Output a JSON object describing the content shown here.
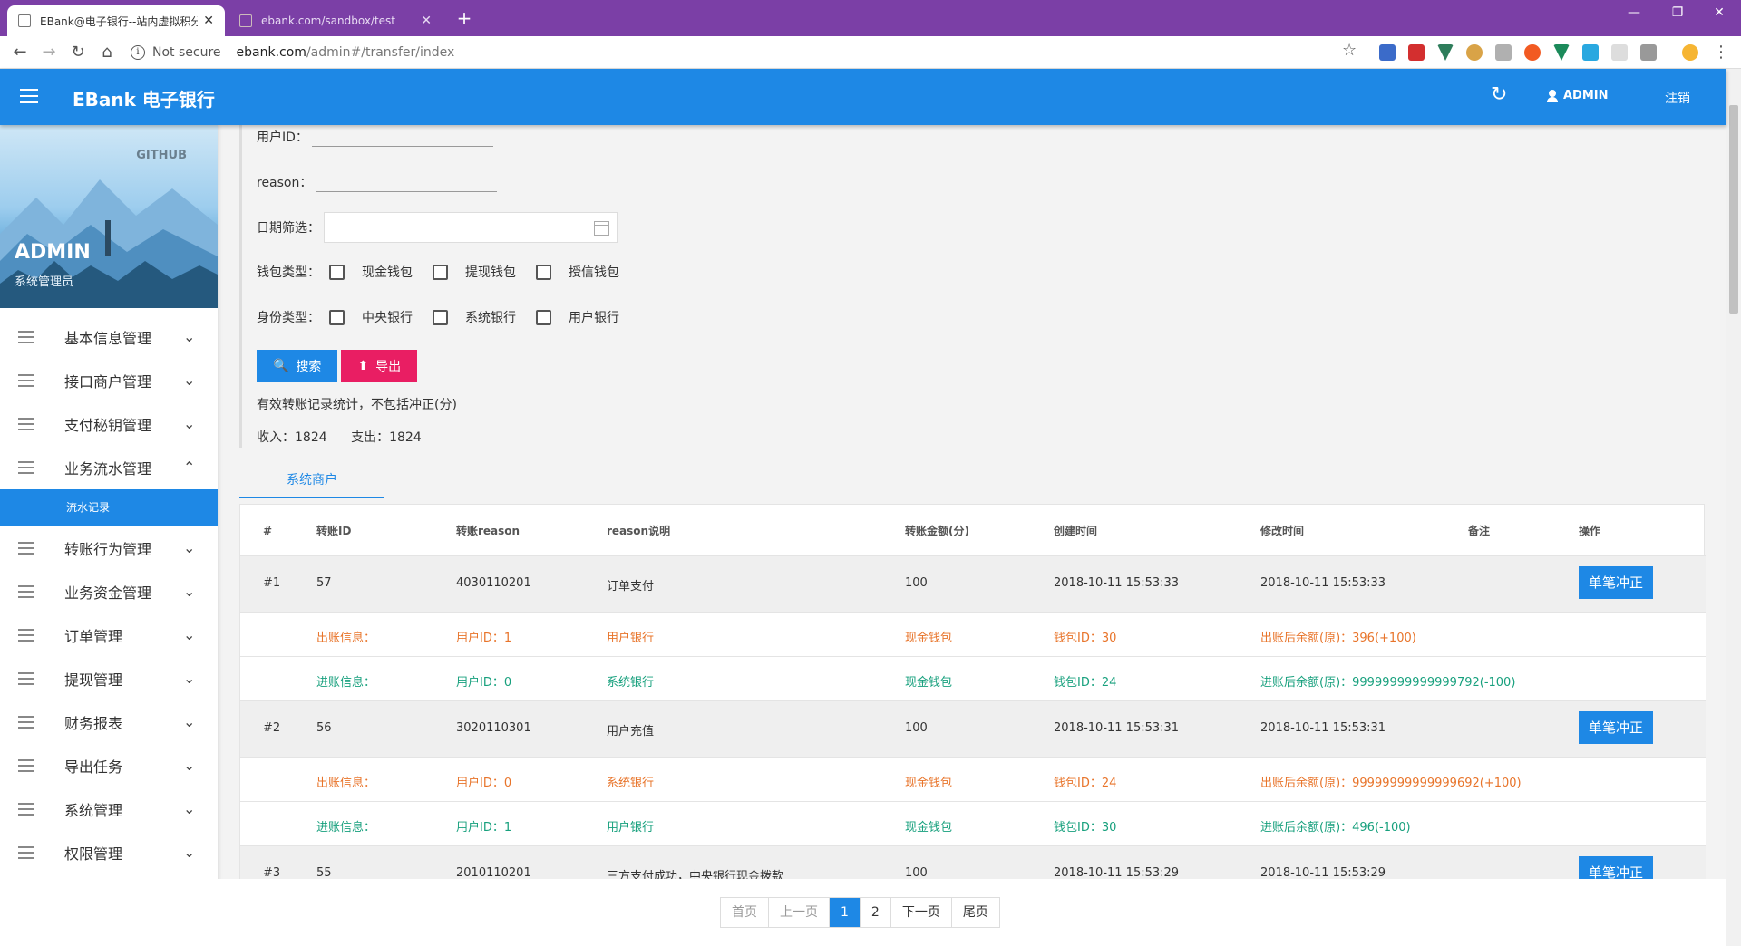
{
  "browser": {
    "tabs": [
      {
        "title": "EBank@电子银行--站内虚拟积分",
        "close": "✕"
      },
      {
        "title": "ebank.com/sandbox/test",
        "close": "✕"
      }
    ],
    "new_tab": "+",
    "window_controls": {
      "minimize": "—",
      "restore": "❐",
      "close": "✕"
    },
    "nav": {
      "back": "←",
      "forward": "→",
      "reload": "↻",
      "home": "⌂"
    },
    "address": {
      "security": "Not secure",
      "host": "ebank.com",
      "path": "/admin#/transfer/index",
      "info": "i"
    },
    "star": "☆"
  },
  "header": {
    "brand": "EBank 电子银行",
    "refresh": "↻",
    "user": "ADMIN",
    "logout": "注销",
    "color": "#1e88e5"
  },
  "profile": {
    "github": "GITHUB",
    "name": "ADMIN",
    "role": "系统管理员"
  },
  "sidebar": {
    "items": [
      {
        "label": "基本信息管理",
        "chevron": "⌄"
      },
      {
        "label": "接口商户管理",
        "chevron": "⌄"
      },
      {
        "label": "支付秘钥管理",
        "chevron": "⌄"
      },
      {
        "label": "业务流水管理",
        "chevron": "⌃"
      },
      {
        "label": "转账行为管理",
        "chevron": "⌄"
      },
      {
        "label": "业务资金管理",
        "chevron": "⌄"
      },
      {
        "label": "订单管理",
        "chevron": "⌄"
      },
      {
        "label": "提现管理",
        "chevron": "⌄"
      },
      {
        "label": "财务报表",
        "chevron": "⌄"
      },
      {
        "label": "导出任务",
        "chevron": "⌄"
      },
      {
        "label": "系统管理",
        "chevron": "⌄"
      },
      {
        "label": "权限管理",
        "chevron": "⌄"
      }
    ],
    "active_sub": "流水记录"
  },
  "filters": {
    "user_id_label": "用户ID：",
    "reason_label": "reason：",
    "date_label": "日期筛选：",
    "wallet_label": "钱包类型：",
    "wallet_options": [
      "现金钱包",
      "提现钱包",
      "授信钱包"
    ],
    "identity_label": "身份类型：",
    "identity_options": [
      "中央银行",
      "系统银行",
      "用户银行"
    ],
    "search_btn": "搜索",
    "export_btn": "导出"
  },
  "stats": {
    "note": "有效转账记录统计，不包括冲正(分)",
    "income_label": "收入：",
    "income": "1824",
    "expense_label": "支出：",
    "expense": "1824"
  },
  "tab": "系统商户",
  "table": {
    "headers": [
      "#",
      "转账ID",
      "转账reason",
      "reason说明",
      "转账金额(分)",
      "创建时间",
      "修改时间",
      "备注",
      "操作"
    ],
    "action_label": "单笔冲正",
    "rows": [
      {
        "no": "#1",
        "id": "57",
        "reason": "4030110201",
        "desc": "订单支付",
        "amount": "100",
        "created": "2018-10-11 15:53:33",
        "updated": "2018-10-11 15:53:33",
        "out": {
          "label": "出账信息：",
          "user": "用户ID：1",
          "bank": "用户银行",
          "wallet": "现金钱包",
          "wallet_id": "钱包ID：30",
          "balance": "出账后余额(原)：396(+100)"
        },
        "in": {
          "label": "进账信息：",
          "user": "用户ID：0",
          "bank": "系统银行",
          "wallet": "现金钱包",
          "wallet_id": "钱包ID：24",
          "balance": "进账后余额(原)：99999999999999792(-100)"
        }
      },
      {
        "no": "#2",
        "id": "56",
        "reason": "3020110301",
        "desc": "用户充值",
        "amount": "100",
        "created": "2018-10-11 15:53:31",
        "updated": "2018-10-11 15:53:31",
        "out": {
          "label": "出账信息：",
          "user": "用户ID：0",
          "bank": "系统银行",
          "wallet": "现金钱包",
          "wallet_id": "钱包ID：24",
          "balance": "出账后余额(原)：99999999999999692(+100)"
        },
        "in": {
          "label": "进账信息：",
          "user": "用户ID：1",
          "bank": "用户银行",
          "wallet": "现金钱包",
          "wallet_id": "钱包ID：30",
          "balance": "进账后余额(原)：496(-100)"
        }
      },
      {
        "no": "#3",
        "id": "55",
        "reason": "2010110201",
        "desc": "三方支付成功，中央银行现金拨款",
        "amount": "100",
        "created": "2018-10-11 15:53:29",
        "updated": "2018-10-11 15:53:29"
      }
    ]
  },
  "pager": {
    "first": "首页",
    "prev": "上一页",
    "pages": [
      "1",
      "2"
    ],
    "current": "1",
    "next": "下一页",
    "last": "尾页"
  }
}
